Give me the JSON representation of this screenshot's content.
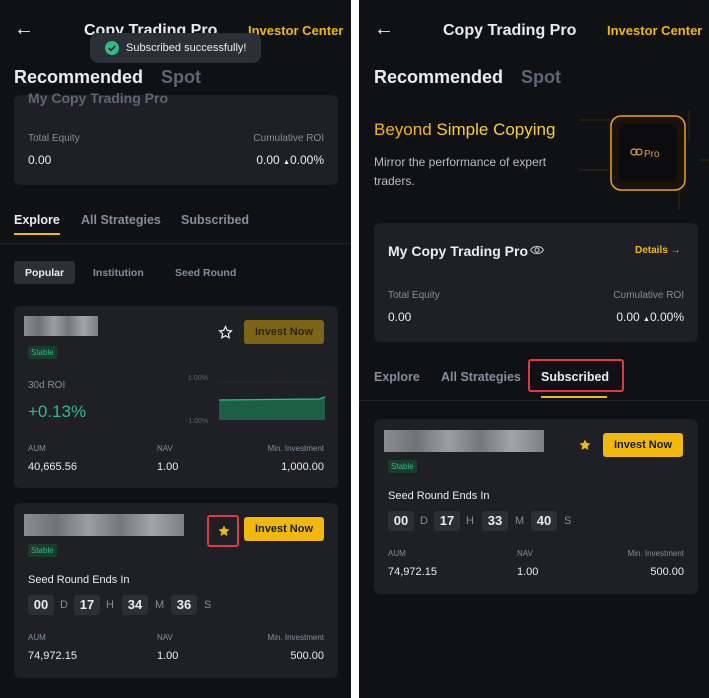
{
  "left": {
    "header": {
      "title": "Copy Trading Pro",
      "investor_center": "Investor Center"
    },
    "toast": {
      "text": "Subscribed successfully!"
    },
    "tabs": [
      "Recommended",
      "Spot"
    ],
    "summary_card": {
      "title_partial": "My Copy Trading Pro",
      "total_equity_label": "Total Equity",
      "total_equity_value": "0.00",
      "cumulative_roi_label": "Cumulative ROI",
      "cumulative_roi_value": "0.00",
      "cumulative_roi_pct": "0.00%"
    },
    "subtabs": [
      "Explore",
      "All Strategies",
      "Subscribed"
    ],
    "filters": [
      "Popular",
      "Institution",
      "Seed Round"
    ],
    "card1": {
      "badge": "Stable",
      "invest_label": "Invest Now",
      "roi_label": "30d ROI",
      "roi_value": "+0.13%",
      "chart_top": "1.00%",
      "chart_bottom": "-1.00%",
      "aum_label": "AUM",
      "aum_value": "40,665.56",
      "nav_label": "NAV",
      "nav_value": "1.00",
      "min_label": "Min. Investment",
      "min_value": "1,000.00"
    },
    "card2": {
      "badge": "Stable",
      "invest_label": "Invest Now",
      "seed_label": "Seed Round Ends In",
      "countdown": {
        "d": "00",
        "d_unit": "D",
        "h": "17",
        "h_unit": "H",
        "m": "34",
        "m_unit": "M",
        "s": "36",
        "s_unit": "S"
      },
      "aum_label": "AUM",
      "aum_value": "74,972.15",
      "nav_label": "NAV",
      "nav_value": "1.00",
      "min_label": "Min. Investment",
      "min_value": "500.00"
    }
  },
  "right": {
    "header": {
      "title": "Copy Trading Pro",
      "investor_center": "Investor Center"
    },
    "tabs": [
      "Recommended",
      "Spot"
    ],
    "banner": {
      "headline_a": "Beyond ",
      "headline_b": "Simple Copying",
      "body": "Mirror the performance of expert traders.",
      "badge_text": "Pro"
    },
    "summary_card": {
      "title": "My Copy Trading Pro",
      "details": "Details",
      "total_equity_label": "Total Equity",
      "total_equity_value": "0.00",
      "cumulative_roi_label": "Cumulative ROI",
      "cumulative_roi_value": "0.00",
      "cumulative_roi_pct": "0.00%"
    },
    "subtabs": [
      "Explore",
      "All Strategies",
      "Subscribed"
    ],
    "card": {
      "badge": "Stable",
      "invest_label": "Invest Now",
      "seed_label": "Seed Round Ends In",
      "countdown": {
        "d": "00",
        "d_unit": "D",
        "h": "17",
        "h_unit": "H",
        "m": "33",
        "m_unit": "M",
        "s": "40",
        "s_unit": "S"
      },
      "aum_label": "AUM",
      "aum_value": "74,972.15",
      "nav_label": "NAV",
      "nav_value": "1.00",
      "min_label": "Min. Investment",
      "min_value": "500.00"
    }
  },
  "colors": {
    "accent": "#f0b90b",
    "green": "#2ebd85",
    "highlight": "#e8353f",
    "bg": "#101114",
    "card": "#1e2026"
  },
  "icons": [
    "back-arrow-icon",
    "check-circle-icon",
    "star-outline-icon",
    "star-filled-icon",
    "eye-icon",
    "arrow-right-icon",
    "triangle-up-icon"
  ]
}
